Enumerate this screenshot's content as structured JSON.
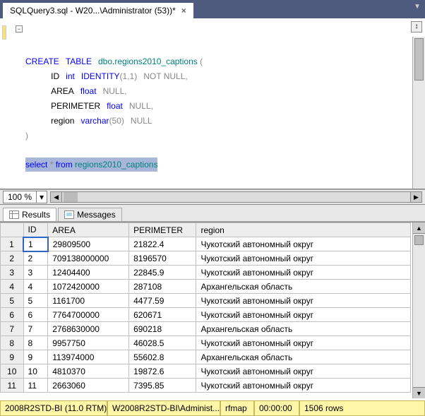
{
  "tab": {
    "title": "SQLQuery3.sql - W20...\\Administrator (53))*",
    "close": "×"
  },
  "code": {
    "line1_kw1": "CREATE",
    "line1_kw2": "TABLE",
    "line1_ident": "dbo",
    "line1_dot": ".",
    "line1_ident2": "regions2010_captions",
    "line1_paren": " (",
    "line2_id": "ID",
    "line2_type": "int",
    "line2_kw": "IDENTITY",
    "line2_args": "(1,1)",
    "line2_nn": "NOT NULL",
    "line2_comma": ",",
    "line3_id": "AREA",
    "line3_type": "float",
    "line3_null": "NULL",
    "line3_comma": ",",
    "line4_id": "PERIMETER",
    "line4_type": "float",
    "line4_null": "NULL",
    "line4_comma": ",",
    "line5_id": "region",
    "line5_type": "varchar",
    "line5_args": "(50)",
    "line5_null": "NULL",
    "line6_paren": ")",
    "sel_kw1": "select",
    "sel_star": " * ",
    "sel_kw2": "from",
    "sel_sp": " ",
    "sel_ident": "regions2010_captions"
  },
  "zoom": {
    "value": "100 %"
  },
  "msgtabs": {
    "results": "Results",
    "messages": "Messages"
  },
  "headers": {
    "id": "ID",
    "area": "AREA",
    "per": "PERIMETER",
    "reg": "region"
  },
  "rows": [
    {
      "n": "1",
      "id": "1",
      "area": "29809500",
      "per": "21822.4",
      "reg": "Чукотский автономный округ"
    },
    {
      "n": "2",
      "id": "2",
      "area": "709138000000",
      "per": "8196570",
      "reg": "Чукотский автономный округ"
    },
    {
      "n": "3",
      "id": "3",
      "area": "12404400",
      "per": "22845.9",
      "reg": "Чукотский автономный округ"
    },
    {
      "n": "4",
      "id": "4",
      "area": "1072420000",
      "per": "287108",
      "reg": "Архангельская область"
    },
    {
      "n": "5",
      "id": "5",
      "area": "1161700",
      "per": "4477.59",
      "reg": "Чукотский автономный округ"
    },
    {
      "n": "6",
      "id": "6",
      "area": "7764700000",
      "per": "620671",
      "reg": "Чукотский автономный округ"
    },
    {
      "n": "7",
      "id": "7",
      "area": "2768630000",
      "per": "690218",
      "reg": "Архангельская область"
    },
    {
      "n": "8",
      "id": "8",
      "area": "9957750",
      "per": "46028.5",
      "reg": "Чукотский автономный округ"
    },
    {
      "n": "9",
      "id": "9",
      "area": "113974000",
      "per": "55602.8",
      "reg": "Архангельская область"
    },
    {
      "n": "10",
      "id": "10",
      "area": "4810370",
      "per": "19872.6",
      "reg": "Чукотский автономный округ"
    },
    {
      "n": "11",
      "id": "11",
      "area": "2663060",
      "per": "7395.85",
      "reg": "Чукотский автономный округ"
    }
  ],
  "status": {
    "server": "2008R2STD-BI (11.0 RTM)",
    "user": "W2008R2STD-BI\\Administ...",
    "db": "rfmap",
    "time": "00:00:00",
    "rows": "1506 rows"
  }
}
